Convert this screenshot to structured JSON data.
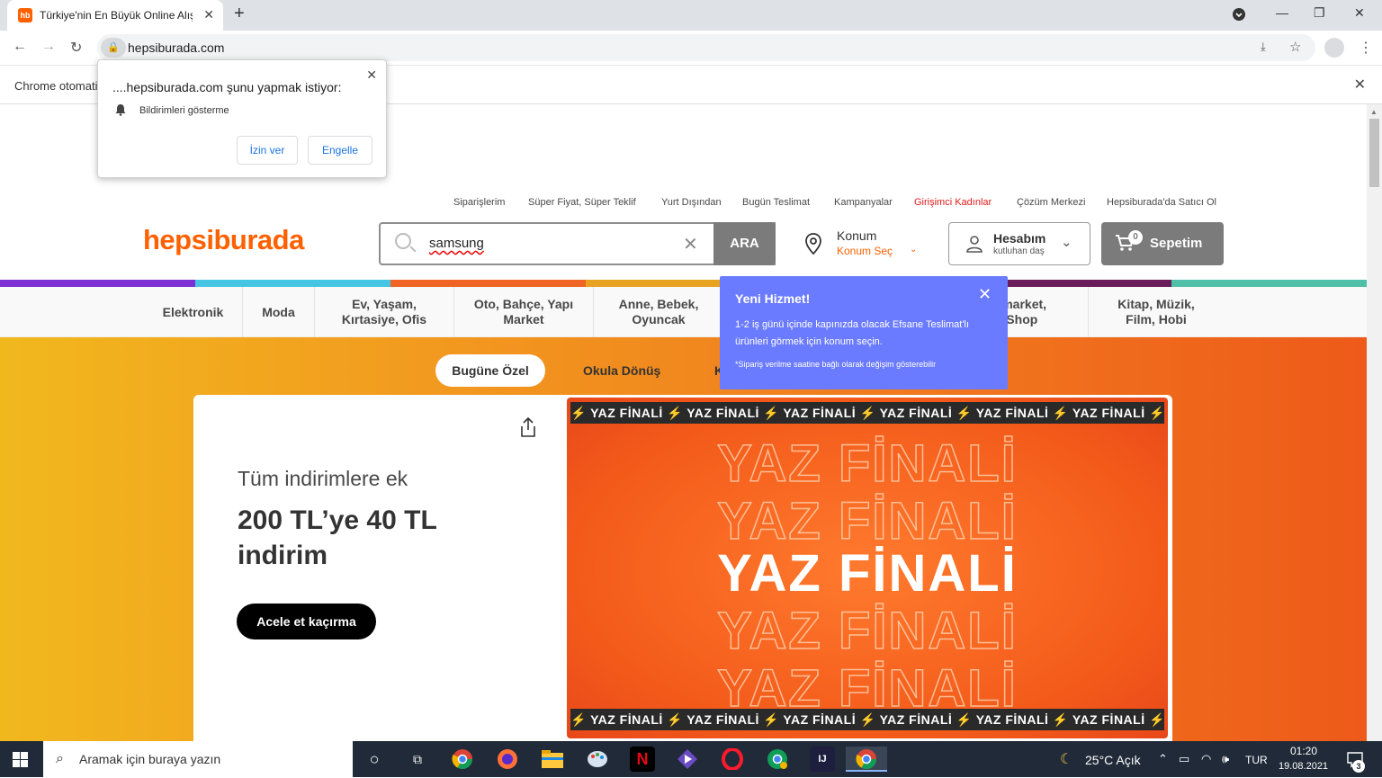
{
  "browser": {
    "tab_title": "Türkiye'nin En Büyük Online Alışv",
    "favicon": "hb",
    "url": "hepsiburada.com",
    "infobar_text": "Chrome otomati"
  },
  "permission_popup": {
    "heading": "....hepsiburada.com şunu yapmak istiyor:",
    "item": "Bildirimleri gösterme",
    "allow": "İzin ver",
    "block": "Engelle"
  },
  "header": {
    "top_links": [
      "Siparişlerim",
      "Süper Fiyat, Süper Teklif",
      "Yurt Dışından",
      "Bugün Teslimat",
      "Kampanyalar",
      "Girişimci Kadınlar",
      "Çözüm Merkezi",
      "Hepsiburada'da Satıcı Ol"
    ],
    "logo": "hepsiburada",
    "search_value": "samsung",
    "search_button": "ARA",
    "location_title": "Konum",
    "location_sub": "Konum Seç",
    "account_title": "Hesabım",
    "account_user": "kutluhan daş",
    "cart_count": "0",
    "cart_label": "Sepetim"
  },
  "categories": [
    "Elektronik",
    "Moda",
    "Ev, Yaşam,\nKırtasiye, Ofis",
    "Oto, Bahçe, Yapı\nMarket",
    "Anne, Bebek,\nOyuncak",
    "ermarket,\nt Shop",
    "Kitap, Müzik,\nFilm, Hobi"
  ],
  "tooltip": {
    "title": "Yeni Hizmet!",
    "body": "1-2 iş günü içinde kapınızda olacak Efsane Teslimat'lı ürünleri görmek için konum seçin.",
    "note": "*Sipariş verilme saatine bağlı olarak değişim gösterebilir"
  },
  "hero": {
    "tabs": [
      "Bugüne Özel",
      "Okula Dönüş",
      "K"
    ],
    "card_line1": "Tüm indirimlere ek",
    "card_line2": "200 TL’ye 40 TL indirim",
    "card_cta": "Acele et kaçırma",
    "banner_ticker": "⚡ YAZ FİNALİ ⚡ YAZ FİNALİ ⚡ YAZ FİNALİ ⚡ YAZ FİNALİ ⚡ YAZ FİNALİ ⚡ YAZ FİNALİ ⚡",
    "banner_title": "YAZ FİNALİ"
  },
  "taskbar": {
    "search_placeholder": "Aramak için buraya yazın",
    "weather": "25°C  Açık",
    "lang": "TUR",
    "time": "01:20",
    "date": "19.08.2021",
    "notification_count": "3"
  },
  "colors": {
    "brand": "#ff6000",
    "tooltip": "#6b7bff",
    "highlight_link": "#e11b1b"
  }
}
